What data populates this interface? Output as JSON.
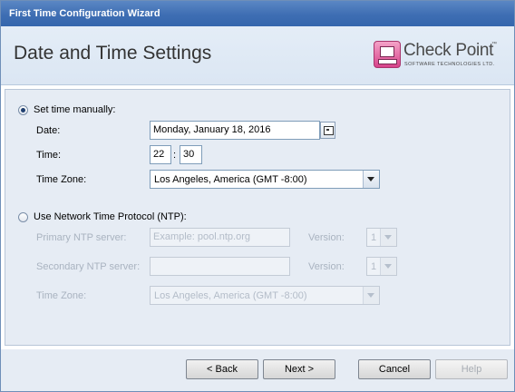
{
  "window": {
    "title": "First Time Configuration Wizard"
  },
  "header": {
    "title": "Date and Time Settings",
    "logo": {
      "name": "Check Point",
      "trademark": "™",
      "subtitle": "SOFTWARE TECHNOLOGIES LTD."
    }
  },
  "manual": {
    "option_label": "Set time manually:",
    "selected": true,
    "date_label": "Date:",
    "date_value": "Monday, January 18, 2016",
    "time_label": "Time:",
    "time_hour": "22",
    "time_separator": ":",
    "time_minute": "30",
    "timezone_label": "Time Zone:",
    "timezone_value": "Los Angeles, America (GMT -8:00)"
  },
  "ntp": {
    "option_label": "Use Network Time Protocol (NTP):",
    "selected": false,
    "primary_label": "Primary NTP server:",
    "primary_placeholder": "Example: pool.ntp.org",
    "primary_version_label": "Version:",
    "primary_version_value": "1",
    "secondary_label": "Secondary NTP server:",
    "secondary_value": "",
    "secondary_version_label": "Version:",
    "secondary_version_value": "1",
    "timezone_label": "Time Zone:",
    "timezone_value": "Los Angeles, America (GMT -8:00)"
  },
  "footer": {
    "back_label": "< Back",
    "next_label": "Next >",
    "cancel_label": "Cancel",
    "help_label": "Help"
  },
  "colors": {
    "titlebar": "#3e6eb3",
    "panel": "#e6ecf4",
    "logo_accent": "#d7438b"
  }
}
